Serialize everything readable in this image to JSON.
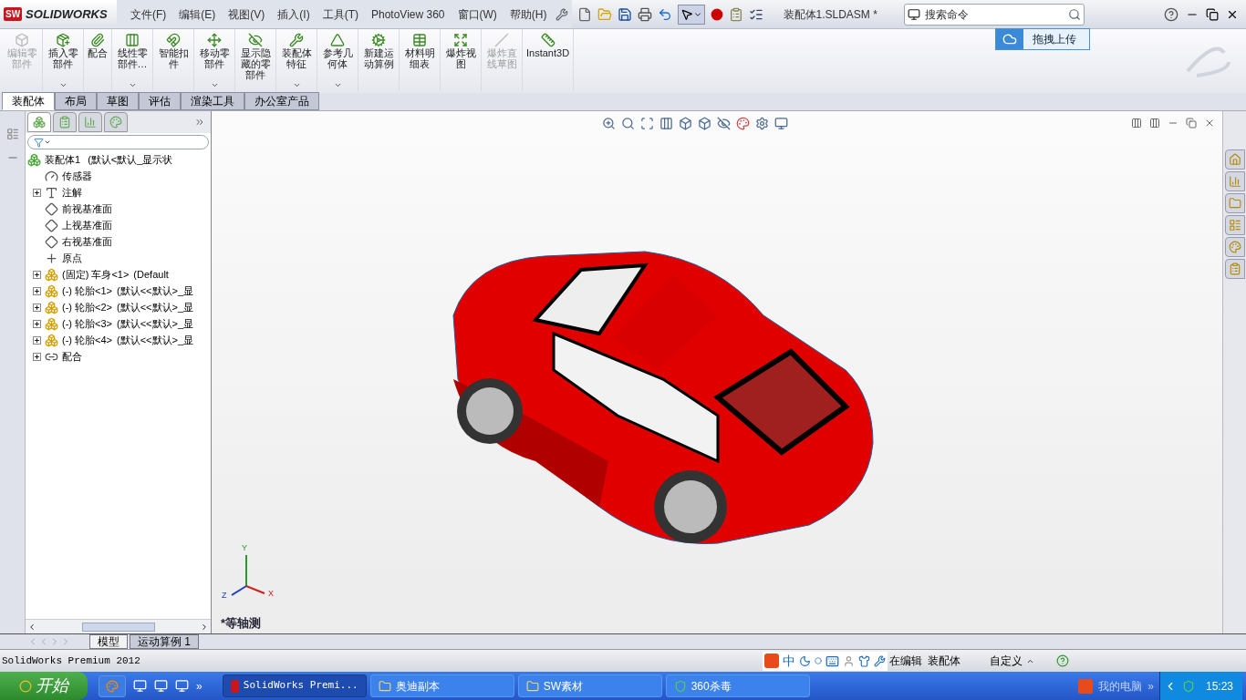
{
  "app": {
    "badge": "SW",
    "logo": "SOLIDWORKS"
  },
  "menu": [
    {
      "label": "文件(F)"
    },
    {
      "label": "编辑(E)"
    },
    {
      "label": "视图(V)"
    },
    {
      "label": "插入(I)"
    },
    {
      "label": "工具(T)"
    },
    {
      "label": "PhotoView 360"
    },
    {
      "label": "窗口(W)"
    },
    {
      "label": "帮助(H)"
    }
  ],
  "document_title": "装配体1.SLDASM *",
  "search": {
    "placeholder": "搜索命令"
  },
  "upload_tip": {
    "label": "拖拽上传"
  },
  "ribbon": [
    {
      "kind": "edit-part",
      "label": "编辑零部件",
      "disabled": true,
      "dropdown": false
    },
    {
      "kind": "insert",
      "label": "插入零部件",
      "disabled": false,
      "dropdown": true
    },
    {
      "kind": "mate",
      "label": "配合",
      "disabled": false,
      "dropdown": false
    },
    {
      "kind": "pattern",
      "label": "线性零部件…",
      "disabled": false,
      "dropdown": true
    },
    {
      "kind": "fastener",
      "label": "智能扣件",
      "disabled": false,
      "dropdown": false
    },
    {
      "kind": "move",
      "label": "移动零部件",
      "disabled": false,
      "dropdown": true
    },
    {
      "kind": "hide",
      "label": "显示隐藏的零部件",
      "disabled": false,
      "dropdown": false
    },
    {
      "kind": "feature",
      "label": "装配体特征",
      "disabled": false,
      "dropdown": true
    },
    {
      "kind": "geometry",
      "label": "参考几何体",
      "disabled": false,
      "dropdown": true
    },
    {
      "kind": "motion",
      "label": "新建运动算例",
      "disabled": false,
      "dropdown": false
    },
    {
      "kind": "bom",
      "label": "材料明细表",
      "disabled": false,
      "dropdown": false
    },
    {
      "kind": "explode",
      "label": "爆炸视图",
      "disabled": false,
      "dropdown": false
    },
    {
      "kind": "explode-line",
      "label": "爆炸直线草图",
      "disabled": true,
      "dropdown": false
    },
    {
      "kind": "instant3d",
      "label": "Instant3D",
      "disabled": false,
      "dropdown": false
    }
  ],
  "ribbon_tabs": [
    {
      "label": "装配体",
      "selected": true
    },
    {
      "label": "布局",
      "selected": false
    },
    {
      "label": "草图",
      "selected": false
    },
    {
      "label": "评估",
      "selected": false
    },
    {
      "label": "渲染工具",
      "selected": false
    },
    {
      "label": "办公室产品",
      "selected": false
    }
  ],
  "tree": {
    "label": "装配体1",
    "detail": "(默认<默认_显示状",
    "children": [
      {
        "kind": "sensor",
        "label": "传感器",
        "toggle": false
      },
      {
        "kind": "annotation",
        "label": "注解",
        "toggle": true
      },
      {
        "kind": "plane",
        "label": "前视基准面",
        "toggle": false
      },
      {
        "kind": "plane",
        "label": "上视基准面",
        "toggle": false
      },
      {
        "kind": "plane",
        "label": "右视基准面",
        "toggle": false
      },
      {
        "kind": "origin",
        "label": "原点",
        "toggle": false
      },
      {
        "kind": "fixed-part",
        "label": "(固定) 车身<1>",
        "detail": "(Default",
        "toggle": true
      },
      {
        "kind": "part",
        "label": "(-) 轮胎<1>",
        "detail": "(默认<<默认>_显",
        "toggle": true
      },
      {
        "kind": "part",
        "label": "(-) 轮胎<2>",
        "detail": "(默认<<默认>_显",
        "toggle": true
      },
      {
        "kind": "part",
        "label": "(-) 轮胎<3>",
        "detail": "(默认<<默认>_显",
        "toggle": true
      },
      {
        "kind": "part",
        "label": "(-) 轮胎<4>",
        "detail": "(默认<<默认>_显",
        "toggle": true
      },
      {
        "kind": "mates",
        "label": "配合",
        "toggle": true
      }
    ]
  },
  "tree_panel_tabs": [
    {
      "kind": "feature-tree",
      "selected": true
    },
    {
      "kind": "properties",
      "selected": false
    },
    {
      "kind": "configurations",
      "selected": false
    },
    {
      "kind": "appearance",
      "selected": false
    }
  ],
  "view": {
    "orientation": "*等轴测",
    "axes": [
      "Y",
      "X",
      "Z"
    ]
  },
  "panel_tabs": [
    {
      "label": "模型",
      "selected": true
    },
    {
      "label": "运动算例 1",
      "selected": false
    }
  ],
  "status_bar": {
    "product": "SolidWorks Premium 2012",
    "ime": "中",
    "mode": "在编辑",
    "doc_type": "装配体",
    "units": "自定义"
  },
  "taskbar": {
    "start": "开始",
    "more": "»",
    "tasks": [
      {
        "kind": "app",
        "label": "SolidWorks Premi...",
        "selected": true
      },
      {
        "kind": "folder",
        "label": "奥迪副本",
        "selected": false
      },
      {
        "kind": "folder",
        "label": "SW素材",
        "selected": false
      },
      {
        "kind": "shield",
        "label": "360杀毒",
        "selected": false
      }
    ],
    "tray_label": "我的电脑",
    "tray_more": "»",
    "clock": "15:23"
  }
}
